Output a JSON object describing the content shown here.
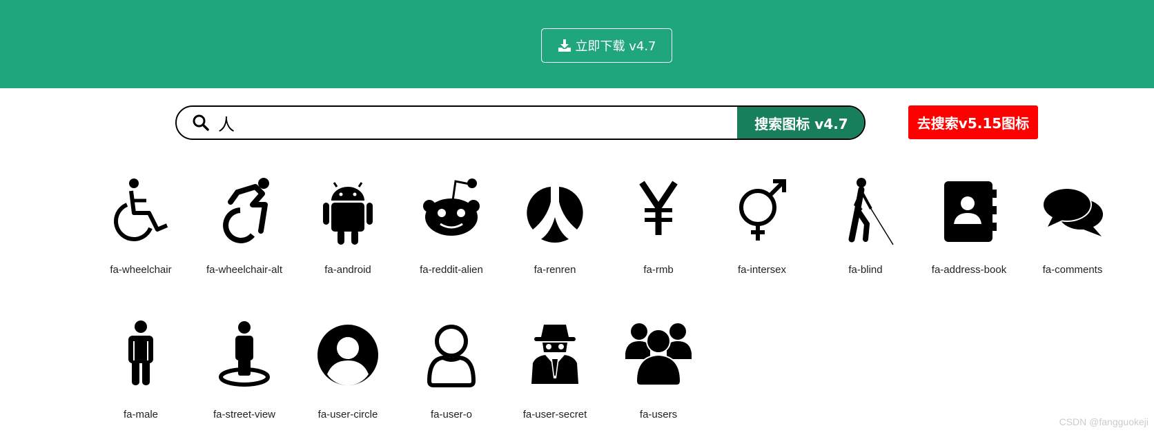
{
  "header": {
    "download_label": "立即下载 v4.7",
    "accent_color": "#1fa67a"
  },
  "search": {
    "value": "人",
    "button_label": "搜索图标 v4.7",
    "alt_button_label": "去搜索v5.15图标"
  },
  "icons": [
    {
      "name": "fa-wheelchair"
    },
    {
      "name": "fa-wheelchair-alt"
    },
    {
      "name": "fa-android"
    },
    {
      "name": "fa-reddit-alien"
    },
    {
      "name": "fa-renren"
    },
    {
      "name": "fa-rmb"
    },
    {
      "name": "fa-intersex"
    },
    {
      "name": "fa-blind"
    },
    {
      "name": "fa-address-book"
    },
    {
      "name": "fa-comments"
    },
    {
      "name": "fa-male"
    },
    {
      "name": "fa-street-view"
    },
    {
      "name": "fa-user-circle"
    },
    {
      "name": "fa-user-o"
    },
    {
      "name": "fa-user-secret"
    },
    {
      "name": "fa-users"
    }
  ],
  "watermark": "CSDN @fangguokeji"
}
